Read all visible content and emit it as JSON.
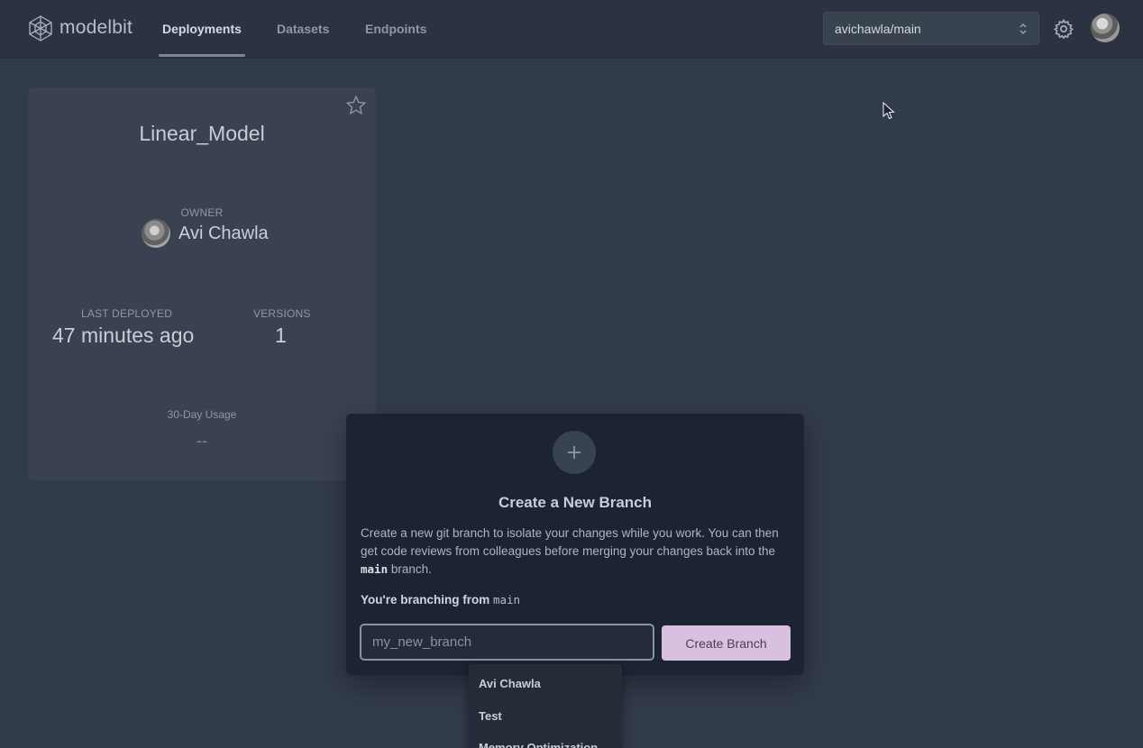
{
  "header": {
    "logo_text": "modelbit",
    "nav": [
      {
        "label": "Deployments",
        "active": true
      },
      {
        "label": "Datasets",
        "active": false
      },
      {
        "label": "Endpoints",
        "active": false
      }
    ],
    "branch_selector": {
      "value": "avichawla/main",
      "icon": "chevron-up-down-icon"
    },
    "settings_icon": "gear-icon"
  },
  "deployment_card": {
    "title": "Linear_Model",
    "owner_label": "OWNER",
    "owner_name": "Avi Chawla",
    "last_deployed_label": "LAST DEPLOYED",
    "last_deployed_value": "47 minutes ago",
    "versions_label": "VERSIONS",
    "versions_value": "1",
    "usage_label": "30-Day Usage",
    "usage_value": "--"
  },
  "modal": {
    "title": "Create a New Branch",
    "description_part1": "Create a new git branch to isolate your changes while you work. You can then get code reviews from colleagues before merging your changes back into the ",
    "description_code": "main",
    "description_part2": " branch.",
    "branching_from_label": "You're branching from ",
    "branching_from_value": "main",
    "input_placeholder": "my_new_branch",
    "button_label": "Create Branch"
  },
  "dropdown": {
    "items": [
      "Avi Chawla",
      "Test",
      "Memory Optimization"
    ]
  },
  "colors": {
    "background": "#323b4c",
    "topbar": "#2b3342",
    "modal": "#1c2332",
    "primary_button": "#d9bfe0"
  }
}
